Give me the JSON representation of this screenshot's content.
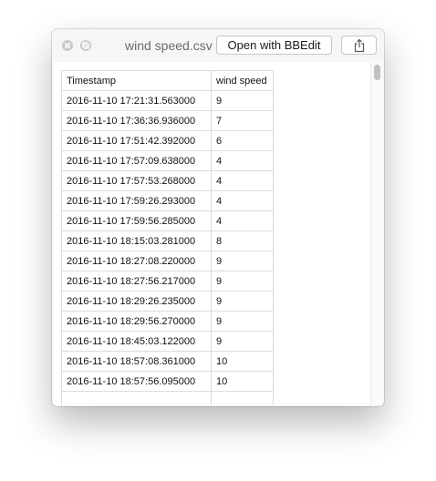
{
  "window": {
    "title": "wind speed.csv",
    "open_button_label": "Open with BBEdit",
    "share_icon": "share-icon"
  },
  "table": {
    "headers": [
      "Timestamp",
      "wind speed"
    ],
    "rows": [
      [
        "2016-11-10 17:21:31.563000",
        "9"
      ],
      [
        "2016-11-10 17:36:36.936000",
        "7"
      ],
      [
        "2016-11-10 17:51:42.392000",
        "6"
      ],
      [
        "2016-11-10 17:57:09.638000",
        "4"
      ],
      [
        "2016-11-10 17:57:53.268000",
        "4"
      ],
      [
        "2016-11-10 17:59:26.293000",
        "4"
      ],
      [
        "2016-11-10 17:59:56.285000",
        "4"
      ],
      [
        "2016-11-10 18:15:03.281000",
        "8"
      ],
      [
        "2016-11-10 18:27:08.220000",
        "9"
      ],
      [
        "2016-11-10 18:27:56.217000",
        "9"
      ],
      [
        "2016-11-10 18:29:26.235000",
        "9"
      ],
      [
        "2016-11-10 18:29:56.270000",
        "9"
      ],
      [
        "2016-11-10 18:45:03.122000",
        "9"
      ],
      [
        "2016-11-10 18:57:08.361000",
        "10"
      ],
      [
        "2016-11-10 18:57:56.095000",
        "10"
      ],
      [
        "",
        ""
      ]
    ]
  }
}
